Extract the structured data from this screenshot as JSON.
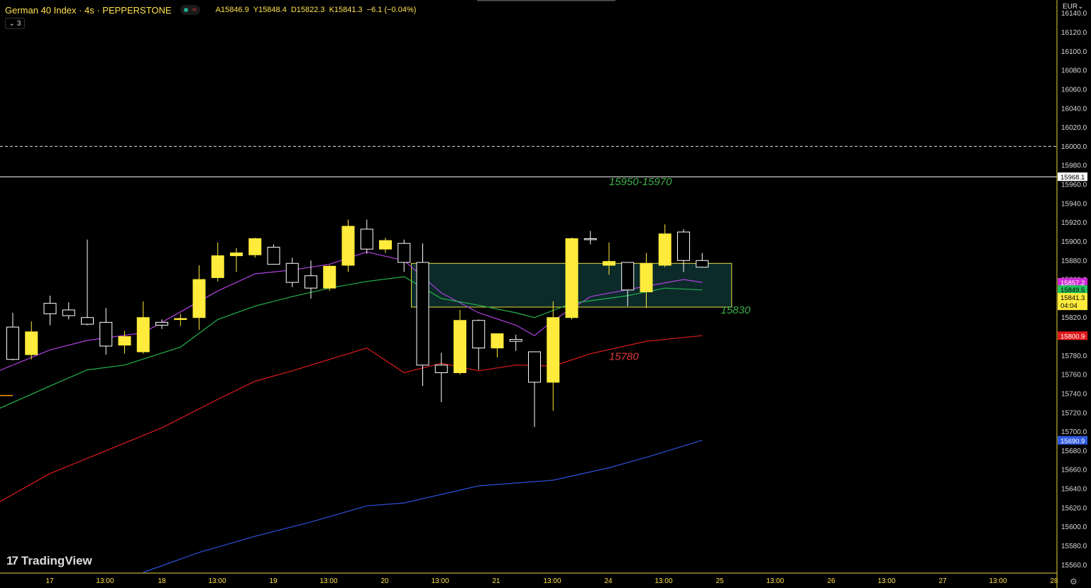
{
  "header": {
    "symbol": "German 40 Index · 4s · PEPPERSTONE",
    "status_wave": "≈",
    "ohlc": [
      "A15846.9",
      "Y15848.4",
      "D15822.3",
      "K15841.3",
      "−6.1 (−0.04%)"
    ],
    "indicator_count": "3",
    "currency": "EUR"
  },
  "logo": {
    "mark": "17",
    "text": "TradingView"
  },
  "colors": {
    "bull": "#ffeb3b",
    "bear": "#000000",
    "wick": "#ffeb3b",
    "bear_border": "#ffffff",
    "ema_fast": "#b040e0",
    "ema_mid": "#22b24c",
    "ema_slow": "#e01b1b",
    "ema_long": "#2f4fd8",
    "zone_fill": "#0c2a2a",
    "zone_border": "#e6dc3c",
    "ann_green": "#3fae49",
    "ann_red": "#e03a3a"
  },
  "chart_data": {
    "type": "candlestick",
    "y_axis": {
      "ticks": [
        16140,
        16120,
        16100,
        16080,
        16060,
        16040,
        16020,
        16000,
        15980,
        15960,
        15940,
        15920,
        15900,
        15880,
        15860,
        15840,
        15820,
        15800,
        15780,
        15760,
        15740,
        15720,
        15700,
        15680,
        15660,
        15640,
        15620,
        15600,
        15580,
        15560
      ],
      "tick_labels": [
        "16140.0",
        "16120.0",
        "16100.0",
        "16080.0",
        "16060.0",
        "16040.0",
        "16020.0",
        "16000.0",
        "15980.0",
        "15960.0",
        "15940.0",
        "15920.0",
        "15900.0",
        "15880.0",
        "15860.0",
        "15840.0",
        "15820.0",
        "15800.0",
        "15780.0",
        "15760.0",
        "15740.0",
        "15720.0",
        "15700.0",
        "15680.0",
        "15660.0",
        "15640.0",
        "15620.0",
        "15600.0",
        "15580.0",
        "15560.0"
      ],
      "range": [
        15552,
        16148
      ]
    },
    "x_axis": {
      "ticks": [
        "17",
        "13:00",
        "18",
        "13:00",
        "19",
        "13:00",
        "20",
        "13:00",
        "21",
        "13:00",
        "24",
        "13:00",
        "25",
        "13:00",
        "26",
        "13:00",
        "27",
        "13:00",
        "28"
      ],
      "range": [
        0,
        38
      ]
    },
    "candles": [
      {
        "t": 1,
        "o": 15810,
        "h": 15825,
        "l": 15775,
        "c": 15776
      },
      {
        "t": 2,
        "o": 15781,
        "h": 15816,
        "l": 15776,
        "c": 15805
      },
      {
        "t": 3,
        "o": 15835,
        "h": 15843,
        "l": 15812,
        "c": 15824
      },
      {
        "t": 4,
        "o": 15828,
        "h": 15836,
        "l": 15818,
        "c": 15822
      },
      {
        "t": 5,
        "o": 15820,
        "h": 15902,
        "l": 15812,
        "c": 15813
      },
      {
        "t": 6,
        "o": 15815,
        "h": 15830,
        "l": 15781,
        "c": 15790
      },
      {
        "t": 7,
        "o": 15791,
        "h": 15806,
        "l": 15782,
        "c": 15800
      },
      {
        "t": 8,
        "o": 15784,
        "h": 15837,
        "l": 15782,
        "c": 15820
      },
      {
        "t": 9,
        "o": 15815,
        "h": 15818,
        "l": 15808,
        "c": 15812
      },
      {
        "t": 10,
        "o": 15818,
        "h": 15824,
        "l": 15811,
        "c": 15819
      },
      {
        "t": 11,
        "o": 15820,
        "h": 15875,
        "l": 15807,
        "c": 15860
      },
      {
        "t": 12,
        "o": 15862,
        "h": 15899,
        "l": 15858,
        "c": 15885
      },
      {
        "t": 13,
        "o": 15885,
        "h": 15893,
        "l": 15868,
        "c": 15888
      },
      {
        "t": 14,
        "o": 15886,
        "h": 15904,
        "l": 15883,
        "c": 15903
      },
      {
        "t": 15,
        "o": 15894,
        "h": 15897,
        "l": 15876,
        "c": 15876
      },
      {
        "t": 16,
        "o": 15877,
        "h": 15883,
        "l": 15852,
        "c": 15857
      },
      {
        "t": 17,
        "o": 15864,
        "h": 15880,
        "l": 15840,
        "c": 15851
      },
      {
        "t": 18,
        "o": 15851,
        "h": 15875,
        "l": 15848,
        "c": 15874
      },
      {
        "t": 19,
        "o": 15875,
        "h": 15923,
        "l": 15868,
        "c": 15916
      },
      {
        "t": 20,
        "o": 15913,
        "h": 15923,
        "l": 15887,
        "c": 15892
      },
      {
        "t": 21,
        "o": 15892,
        "h": 15904,
        "l": 15888,
        "c": 15901
      },
      {
        "t": 22,
        "o": 15898,
        "h": 15902,
        "l": 15868,
        "c": 15878
      },
      {
        "t": 23,
        "o": 15878,
        "h": 15898,
        "l": 15748,
        "c": 15770
      },
      {
        "t": 24,
        "o": 15770,
        "h": 15783,
        "l": 15731,
        "c": 15762
      },
      {
        "t": 25,
        "o": 15762,
        "h": 15828,
        "l": 15760,
        "c": 15817
      },
      {
        "t": 26,
        "o": 15817,
        "h": 15818,
        "l": 15765,
        "c": 15788
      },
      {
        "t": 27,
        "o": 15788,
        "h": 15802,
        "l": 15778,
        "c": 15803
      },
      {
        "t": 28,
        "o": 15797,
        "h": 15802,
        "l": 15785,
        "c": 15795
      },
      {
        "t": 29,
        "o": 15784,
        "h": 15783,
        "l": 15705,
        "c": 15752
      },
      {
        "t": 30,
        "o": 15752,
        "h": 15837,
        "l": 15722,
        "c": 15820
      },
      {
        "t": 31,
        "o": 15820,
        "h": 15904,
        "l": 15818,
        "c": 15903
      },
      {
        "t": 32,
        "o": 15903,
        "h": 15911,
        "l": 15897,
        "c": 15902
      },
      {
        "t": 33,
        "o": 15875,
        "h": 15899,
        "l": 15865,
        "c": 15879
      },
      {
        "t": 34,
        "o": 15878,
        "h": 15875,
        "l": 15832,
        "c": 15849
      },
      {
        "t": 35,
        "o": 15847,
        "h": 15888,
        "l": 15830,
        "c": 15877
      },
      {
        "t": 36,
        "o": 15875,
        "h": 15918,
        "l": 15873,
        "c": 15908
      },
      {
        "t": 37,
        "o": 15910,
        "h": 15913,
        "l": 15868,
        "c": 15880
      },
      {
        "t": 38,
        "o": 15880,
        "h": 15888,
        "l": 15875,
        "c": 15873
      }
    ],
    "series": [
      {
        "color": "#b040e0",
        "points": [
          [
            0,
            15762
          ],
          [
            3,
            15786
          ],
          [
            5,
            15796
          ],
          [
            8,
            15804
          ],
          [
            10,
            15826
          ],
          [
            12,
            15848
          ],
          [
            14,
            15866
          ],
          [
            16,
            15870
          ],
          [
            18,
            15876
          ],
          [
            20,
            15889
          ],
          [
            22,
            15880
          ],
          [
            24,
            15846
          ],
          [
            26,
            15825
          ],
          [
            28,
            15812
          ],
          [
            29,
            15801
          ],
          [
            30,
            15817
          ],
          [
            32,
            15842
          ],
          [
            35,
            15853
          ],
          [
            37,
            15860
          ],
          [
            38,
            15857
          ]
        ]
      },
      {
        "color": "#22b24c",
        "points": [
          [
            0,
            15722
          ],
          [
            3,
            15748
          ],
          [
            5,
            15765
          ],
          [
            7,
            15770
          ],
          [
            10,
            15789
          ],
          [
            12,
            15818
          ],
          [
            14,
            15832
          ],
          [
            16,
            15842
          ],
          [
            18,
            15851
          ],
          [
            20,
            15858
          ],
          [
            22,
            15863
          ],
          [
            24,
            15840
          ],
          [
            26,
            15833
          ],
          [
            28,
            15825
          ],
          [
            29,
            15820
          ],
          [
            31,
            15835
          ],
          [
            34,
            15843
          ],
          [
            36,
            15851
          ],
          [
            38,
            15849
          ]
        ]
      },
      {
        "color": "#e01b1b",
        "points": [
          [
            0,
            15623
          ],
          [
            3,
            15656
          ],
          [
            6,
            15680
          ],
          [
            9,
            15704
          ],
          [
            12,
            15734
          ],
          [
            14,
            15753
          ],
          [
            16,
            15764
          ],
          [
            18,
            15776
          ],
          [
            20,
            15788
          ],
          [
            22,
            15762
          ],
          [
            24,
            15772
          ],
          [
            26,
            15764
          ],
          [
            28,
            15770
          ],
          [
            30,
            15769
          ],
          [
            32,
            15782
          ],
          [
            35,
            15795
          ],
          [
            38,
            15801
          ]
        ]
      },
      {
        "color": "#2f4fd8",
        "points": [
          [
            8,
            15552
          ],
          [
            11,
            15573
          ],
          [
            14,
            15590
          ],
          [
            17,
            15605
          ],
          [
            20,
            15622
          ],
          [
            22,
            15625
          ],
          [
            26,
            15643
          ],
          [
            30,
            15649
          ],
          [
            33,
            15662
          ],
          [
            35,
            15673
          ],
          [
            38,
            15691
          ]
        ]
      }
    ],
    "hlines": [
      {
        "value": 16000,
        "color": "#e0e0e0",
        "style": "dashed"
      },
      {
        "value": 15968,
        "color": "#ffffff",
        "style": "solid"
      }
    ],
    "zone": {
      "from": 22,
      "to": 39,
      "top": 15877,
      "bottom": 15831
    },
    "annotations": [
      {
        "text": "15950-15970",
        "t": 33,
        "v": 15963,
        "color": "#3fae49"
      },
      {
        "text": "15830",
        "t": 39,
        "v": 15828,
        "color": "#3fae49"
      },
      {
        "text": "15780",
        "t": 33,
        "v": 15779,
        "color": "#e03a3a"
      }
    ],
    "price_badges": [
      {
        "text": "15968.1",
        "v": 15968.1,
        "bg": "#ffffff",
        "fg": "#000000"
      },
      {
        "text": "15857.2",
        "v": 15857.2,
        "bg": "#d02ad8",
        "fg": "#ffffff"
      },
      {
        "text": "15849.5",
        "v": 15849.5,
        "bg": "#22c55e",
        "fg": "#000000"
      },
      {
        "text": "15841.3",
        "v": 15841.3,
        "bg": "#ffeb3b",
        "fg": "#000000",
        "sub": "04:04"
      },
      {
        "text": "15800.9",
        "v": 15800.9,
        "bg": "#e01b1b",
        "fg": "#ffffff"
      },
      {
        "text": "15690.9",
        "v": 15690.9,
        "bg": "#2f5be0",
        "fg": "#ffffff"
      }
    ]
  }
}
